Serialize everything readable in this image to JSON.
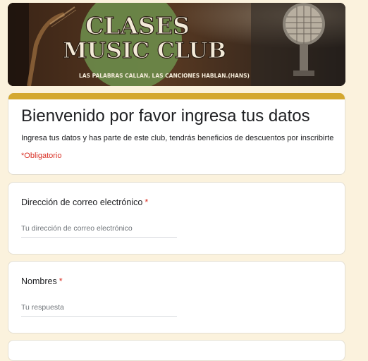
{
  "header": {
    "banner_title_line1": "CLASES",
    "banner_title_line2": "MUSIC CLUB",
    "banner_tagline": "LAS PALABRAS CALLAN, LAS CANCIONES HABLAN.(HANS)"
  },
  "form": {
    "title": "Bienvenido por favor ingresa tus datos",
    "description": "Ingresa tus datos y has parte de este club, tendrás beneficios de descuentos por inscribirte",
    "required_note": "*Obligatorio"
  },
  "questions": [
    {
      "label": "Dirección de correo electrónico",
      "required_marker": "*",
      "placeholder": "Tu dirección de correo electrónico"
    },
    {
      "label": "Nombres",
      "required_marker": "*",
      "placeholder": "Tu respuesta"
    }
  ],
  "colors": {
    "page_background": "#fbf2dd",
    "accent": "#d4a82f",
    "required": "#d93025",
    "banner_circle": "#6b8a4a"
  },
  "icons": {
    "banner_left": "guitar-icon",
    "banner_right": "microphone-icon"
  }
}
